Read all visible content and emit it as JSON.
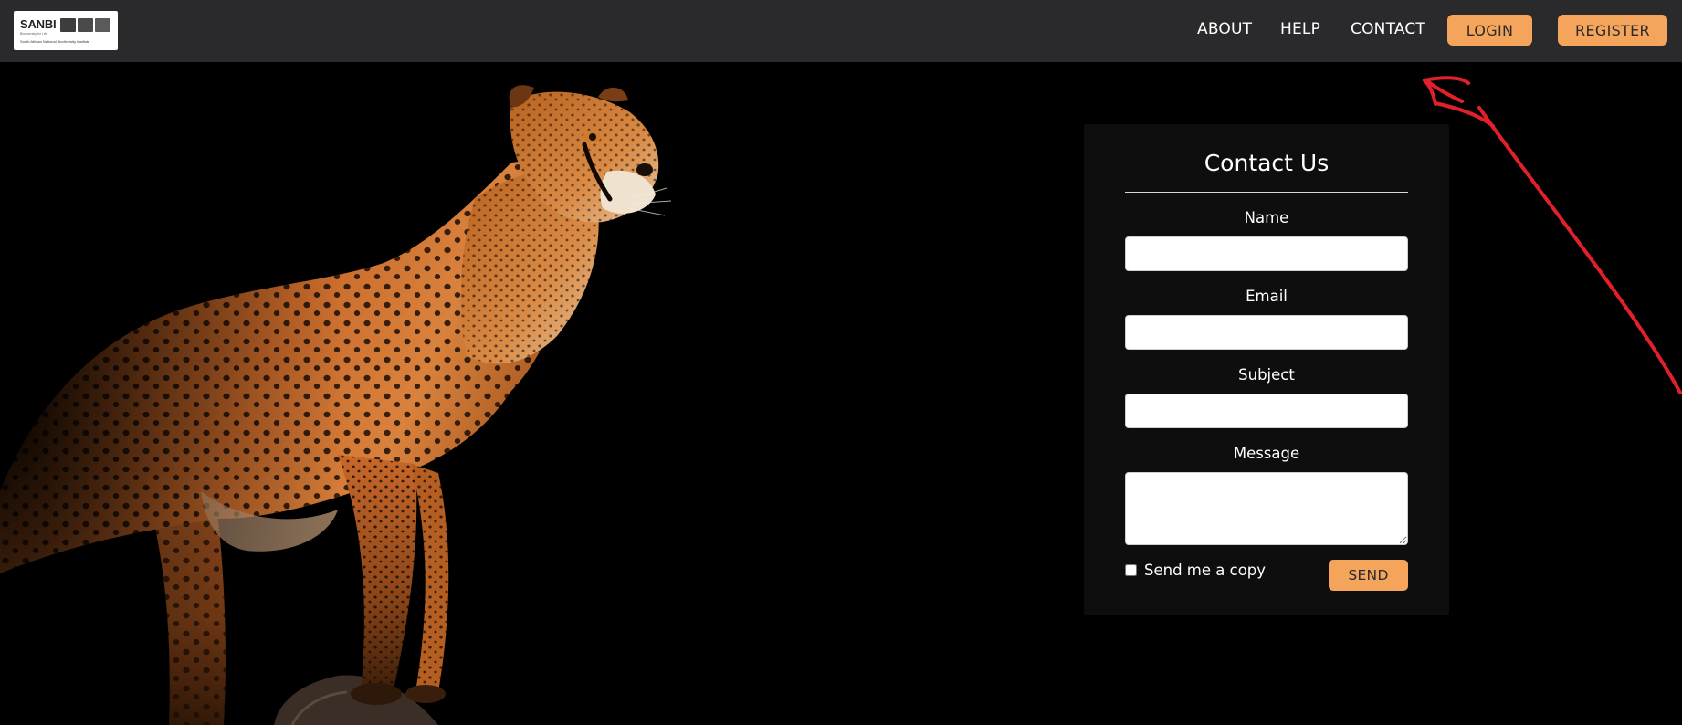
{
  "header": {
    "logo": {
      "name": "SANBI",
      "tagline": "Biodiversity for Life",
      "subtitle": "South African National Biodiversity Institute"
    },
    "nav": [
      {
        "label": "ABOUT"
      },
      {
        "label": "HELP"
      },
      {
        "label": "CONTACT"
      }
    ],
    "login_label": "LOGIN",
    "register_label": "REGISTER"
  },
  "contact_form": {
    "title": "Contact Us",
    "fields": {
      "name": {
        "label": "Name",
        "value": "",
        "placeholder": ""
      },
      "email": {
        "label": "Email",
        "value": "",
        "placeholder": ""
      },
      "subject": {
        "label": "Subject",
        "value": "",
        "placeholder": ""
      },
      "message": {
        "label": "Message",
        "value": "",
        "placeholder": ""
      }
    },
    "copy_label": "Send me a copy",
    "copy_checked": false,
    "send_label": "SEND"
  },
  "colors": {
    "header_bg": "#2a2a2c",
    "accent": "#f4a55b",
    "card_bg": "#0e0e0e",
    "page_bg": "#000000",
    "annotation": "#e0202a"
  },
  "icons": {
    "hero": "cheetah-illustration",
    "annotation": "red-arrow-annotation"
  }
}
